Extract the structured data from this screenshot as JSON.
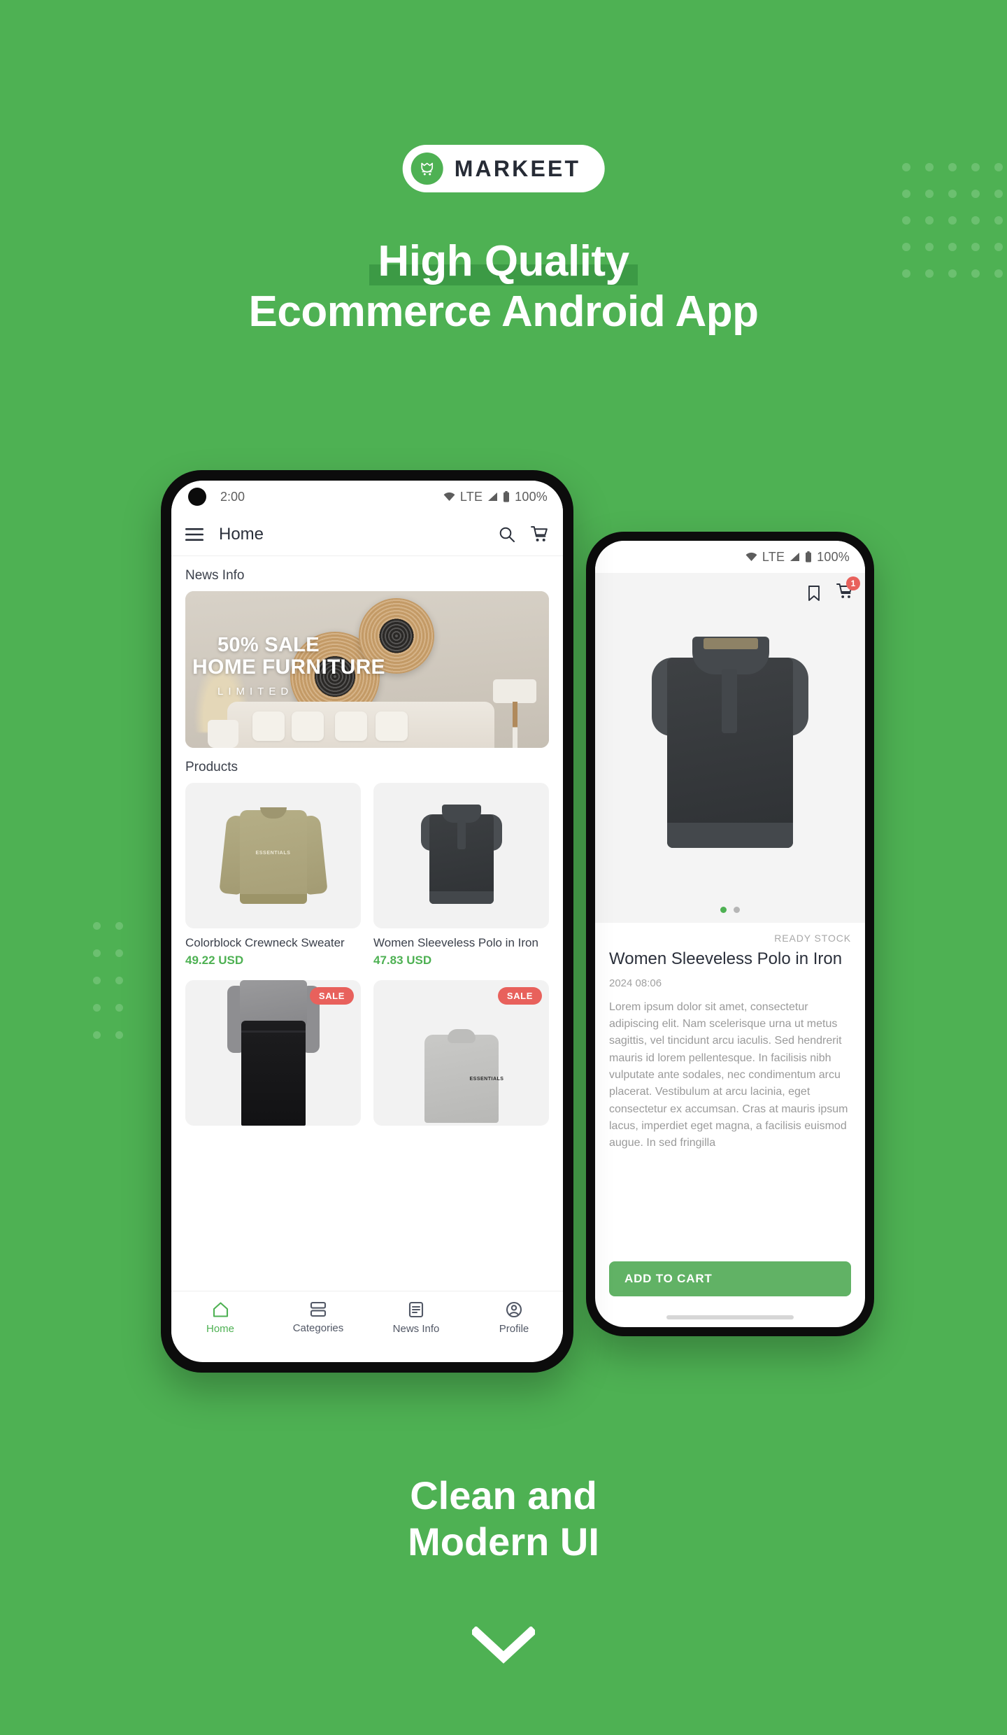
{
  "theme": {
    "brand_green": "#4EB153",
    "highlight_green": "#3C9A45",
    "dot_green": "#6CC070",
    "sale_red": "#E8615C",
    "dark_text": "#2B303B"
  },
  "logo": {
    "text": "MARKEET",
    "icon": "cart-monogram-icon"
  },
  "headline": {
    "line1": "High Quality",
    "line2": "Ecommerce Android App"
  },
  "caption": {
    "line1": "Clean and",
    "line2": "Modern UI"
  },
  "home_phone": {
    "statusbar": {
      "time": "2:00",
      "network": "LTE",
      "battery": "100%"
    },
    "appbar": {
      "title": "Home",
      "menu_icon": "hamburger-menu-icon",
      "search_icon": "search-icon",
      "cart_icon": "cart-icon"
    },
    "sections": {
      "news_label": "News Info",
      "products_label": "Products"
    },
    "banner": {
      "line1": "50% SALE",
      "line2": "HOME FURNITURE",
      "line3": "LIMITED"
    },
    "products": [
      {
        "title": "Colorblock Crewneck Sweater",
        "price": "49.22 USD",
        "badge": "",
        "art": "crew"
      },
      {
        "title": "Women Sleeveless Polo in Iron",
        "price": "47.83 USD",
        "badge": "",
        "art": "polo"
      },
      {
        "title": "",
        "price": "",
        "badge": "SALE",
        "art": "pants"
      },
      {
        "title": "",
        "price": "",
        "badge": "SALE",
        "art": "grey"
      }
    ],
    "bottom_nav": [
      {
        "label": "Home",
        "icon": "home-icon",
        "active": true
      },
      {
        "label": "Categories",
        "icon": "categories-icon",
        "active": false
      },
      {
        "label": "News Info",
        "icon": "news-icon",
        "active": false
      },
      {
        "label": "Profile",
        "icon": "profile-icon",
        "active": false
      }
    ]
  },
  "detail_phone": {
    "statusbar": {
      "network": "LTE",
      "battery": "100%"
    },
    "actions": {
      "bookmark_icon": "bookmark-icon",
      "cart_icon": "cart-icon",
      "cart_count": "1"
    },
    "stock_tag": "READY STOCK",
    "title": "Women Sleeveless Polo in Iron",
    "timestamp": "2024 08:06",
    "description": "Lorem ipsum dolor sit amet, consectetur adipiscing elit. Nam scelerisque urna ut metus sagittis, vel tincidunt arcu iaculis. Sed hendrerit mauris id lorem pellentesque. In facilisis nibh vulputate ante sodales, nec condimentum arcu placerat. Vestibulum at arcu lacinia, eget consectetur ex accumsan. Cras at mauris ipsum lacus, imperdiet eget magna, a facilisis euismod augue. In sed fringilla",
    "add_to_cart": "ADD TO CART",
    "carousel": {
      "total": 2,
      "active": 1
    }
  }
}
